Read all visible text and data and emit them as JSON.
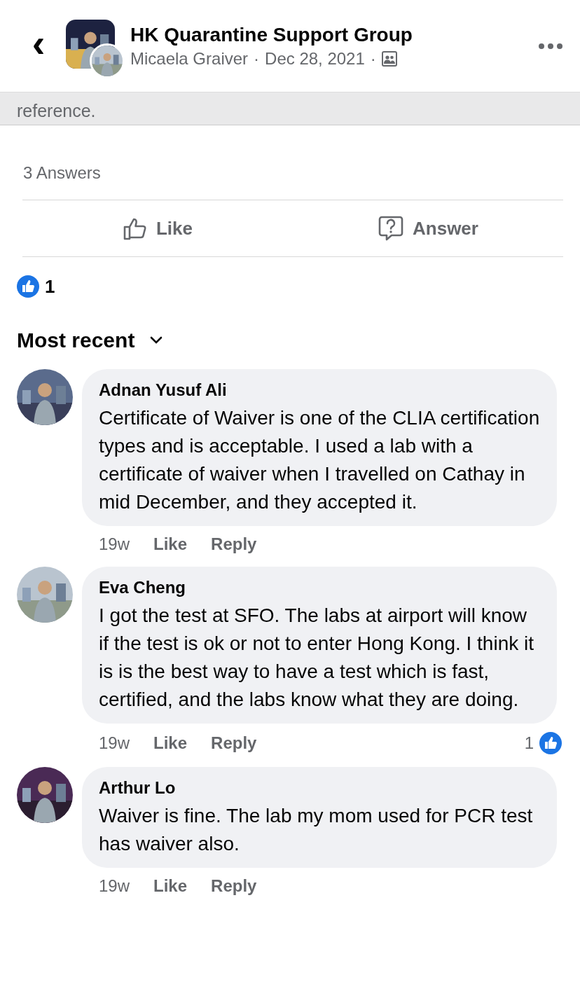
{
  "header": {
    "back": "‹",
    "title": "HK Quarantine Support Group",
    "author": "Micaela Graiver",
    "date": "Dec 28, 2021",
    "separator": "·"
  },
  "post_excerpt": "reference.",
  "answers_count": "3 Answers",
  "actions": [
    {
      "kind": "like",
      "label": "Like"
    },
    {
      "kind": "answer",
      "label": "Answer"
    }
  ],
  "reactions": {
    "count": "1"
  },
  "sort": {
    "label": "Most recent"
  },
  "comments": [
    {
      "author": "Adnan Yusuf Ali",
      "text": "Certificate of Waiver is one of the CLIA certification types and is acceptable. I used a lab with a certificate of waiver when I travelled on Cathay in mid December, and they accepted it.",
      "time": "19w",
      "actions": [
        "Like",
        "Reply"
      ]
    },
    {
      "author": "Eva Cheng",
      "text": "I got the test at SFO. The labs at airport will know if the test is ok or not to enter Hong Kong.  I think it is is the best way to have a test which is fast, certified, and the labs know what they are doing.",
      "time": "19w",
      "actions": [
        "Like",
        "Reply"
      ],
      "reactions": "1"
    },
    {
      "author": "Arthur Lo",
      "text": "Waiver is fine. The lab my mom used for PCR test has waiver also.",
      "time": "19w",
      "actions": [
        "Like",
        "Reply"
      ]
    }
  ]
}
